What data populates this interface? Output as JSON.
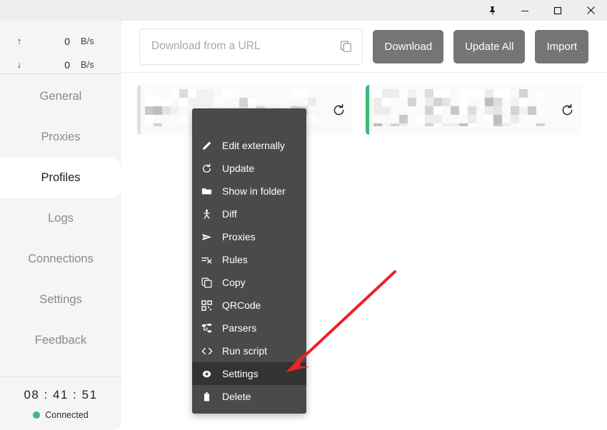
{
  "window": {
    "controls": [
      {
        "name": "pin-icon",
        "label": "Pin"
      },
      {
        "name": "minimize-icon",
        "label": "Minimize"
      },
      {
        "name": "maximize-icon",
        "label": "Maximize"
      },
      {
        "name": "close-icon",
        "label": "Close"
      }
    ]
  },
  "sidebar": {
    "rates": [
      {
        "direction": "up",
        "arrow": "↑",
        "value": "0",
        "unit": "B/s"
      },
      {
        "direction": "down",
        "arrow": "↓",
        "value": "0",
        "unit": "B/s"
      }
    ],
    "items": [
      {
        "label": "General",
        "active": false
      },
      {
        "label": "Proxies",
        "active": false
      },
      {
        "label": "Profiles",
        "active": true
      },
      {
        "label": "Logs",
        "active": false
      },
      {
        "label": "Connections",
        "active": false
      },
      {
        "label": "Settings",
        "active": false
      },
      {
        "label": "Feedback",
        "active": false
      }
    ],
    "status": {
      "clock": "08 : 41 : 51",
      "connection_label": "Connected",
      "connection_color": "#3cb878"
    }
  },
  "toolbar": {
    "url_placeholder": "Download from a URL",
    "url_value": "",
    "paste_icon": "copy-icon",
    "buttons": [
      {
        "label": "Download",
        "name": "download-button"
      },
      {
        "label": "Update All",
        "name": "update-all-button"
      },
      {
        "label": "Import",
        "name": "import-button"
      }
    ]
  },
  "profiles": {
    "cards": [
      {
        "name": "profile-card-1",
        "bar_color": "#e0e0e0",
        "selected": false,
        "refresh_icon": "refresh-icon"
      },
      {
        "name": "profile-card-2",
        "bar_color": "#3cb878",
        "selected": true,
        "refresh_icon": "refresh-icon"
      }
    ]
  },
  "context_menu": {
    "items": [
      {
        "label": "Edit externally",
        "icon": "pencil-icon",
        "selected": false
      },
      {
        "label": "Update",
        "icon": "refresh-icon",
        "selected": false
      },
      {
        "label": "Show in folder",
        "icon": "folder-icon",
        "selected": false
      },
      {
        "label": "Diff",
        "icon": "diff-icon",
        "selected": false
      },
      {
        "label": "Proxies",
        "icon": "send-icon",
        "selected": false
      },
      {
        "label": "Rules",
        "icon": "rules-icon",
        "selected": false
      },
      {
        "label": "Copy",
        "icon": "copy-icon",
        "selected": false
      },
      {
        "label": "QRCode",
        "icon": "qrcode-icon",
        "selected": false
      },
      {
        "label": "Parsers",
        "icon": "parsers-icon",
        "selected": false
      },
      {
        "label": "Run script",
        "icon": "code-icon",
        "selected": false
      },
      {
        "label": "Settings",
        "icon": "gear-icon",
        "selected": true
      },
      {
        "label": "Delete",
        "icon": "trash-icon",
        "selected": false
      }
    ]
  },
  "annotation": {
    "arrow_color": "#ee2222",
    "points_to": "Settings"
  }
}
